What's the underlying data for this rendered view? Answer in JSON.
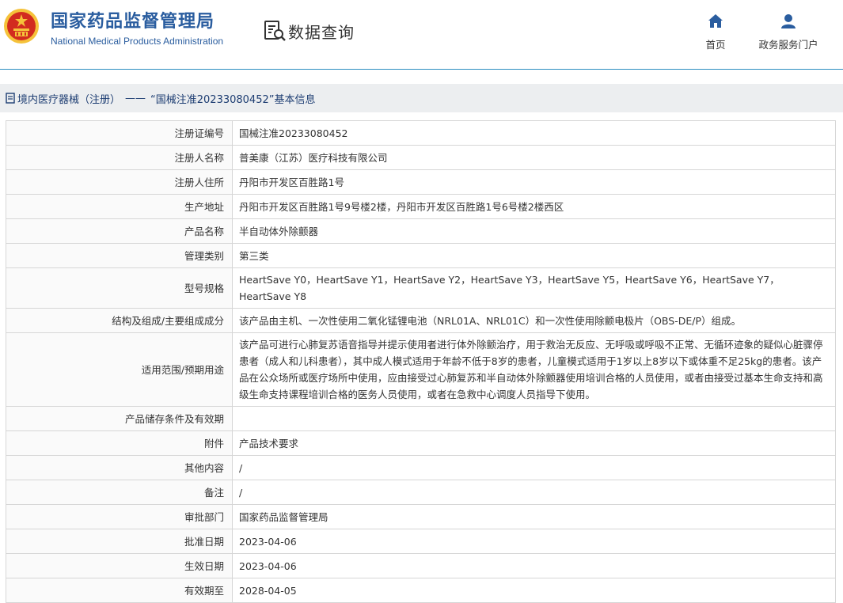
{
  "header": {
    "brand_cn": "国家药品监督管理局",
    "brand_en": "National Medical Products Administration",
    "query_label": "数据查询",
    "nav": [
      {
        "label": "首页",
        "icon": "home-icon"
      },
      {
        "label": "政务服务门户",
        "icon": "user-icon"
      }
    ],
    "colors": {
      "brand": "#2a5d9f",
      "accent": "#2c8fc0",
      "emblem_red": "#d22b1f",
      "emblem_gold": "#f5c23a"
    }
  },
  "breadcrumb": {
    "section": "境内医疗器械（注册）",
    "separator": "——",
    "title": "“国械注准20233080452”基本信息"
  },
  "details": [
    {
      "label": "注册证编号",
      "value": "国械注准20233080452"
    },
    {
      "label": "注册人名称",
      "value": "普美康（江苏）医疗科技有限公司"
    },
    {
      "label": "注册人住所",
      "value": "丹阳市开发区百胜路1号"
    },
    {
      "label": "生产地址",
      "value": "丹阳市开发区百胜路1号9号楼2楼，丹阳市开发区百胜路1号6号楼2楼西区"
    },
    {
      "label": "产品名称",
      "value": "半自动体外除颤器"
    },
    {
      "label": "管理类别",
      "value": "第三类"
    },
    {
      "label": "型号规格",
      "value": "HeartSave Y0，HeartSave Y1，HeartSave Y2，HeartSave Y3，HeartSave Y5，HeartSave Y6，HeartSave Y7，HeartSave Y8"
    },
    {
      "label": "结构及组成/主要组成成分",
      "value": "该产品由主机、一次性使用二氧化锰锂电池（NRL01A、NRL01C）和一次性使用除颤电极片（OBS-DE/P）组成。"
    },
    {
      "label": "适用范围/预期用途",
      "value": "该产品可进行心肺复苏语音指导并提示使用者进行体外除颤治疗，用于救治无反应、无呼吸或呼吸不正常、无循环迹象的疑似心脏骤停患者（成人和儿科患者），其中成人模式适用于年龄不低于8岁的患者，儿童模式适用于1岁以上8岁以下或体重不足25kg的患者。该产品在公众场所或医疗场所中使用，应由接受过心肺复苏和半自动体外除颤器使用培训合格的人员使用，或者由接受过基本生命支持和高级生命支持课程培训合格的医务人员使用，或者在急救中心调度人员指导下使用。"
    },
    {
      "label": "产品储存条件及有效期",
      "value": ""
    },
    {
      "label": "附件",
      "value": "产品技术要求"
    },
    {
      "label": "其他内容",
      "value": "/"
    },
    {
      "label": "备注",
      "value": "/"
    },
    {
      "label": "审批部门",
      "value": "国家药品监督管理局"
    },
    {
      "label": "批准日期",
      "value": "2023-04-06"
    },
    {
      "label": "生效日期",
      "value": "2023-04-06"
    },
    {
      "label": "有效期至",
      "value": "2028-04-05"
    }
  ]
}
